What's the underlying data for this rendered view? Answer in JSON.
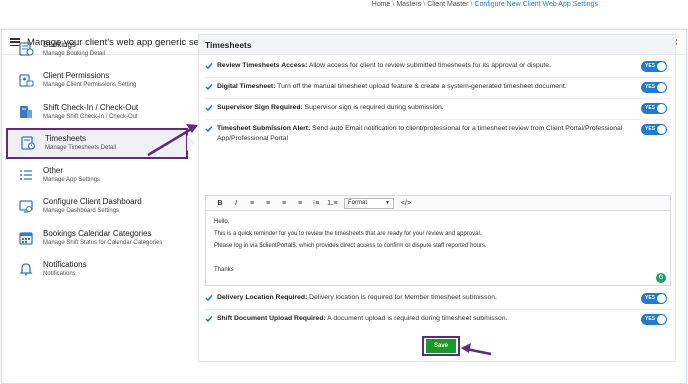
{
  "breadcrumb": {
    "items": [
      "Home",
      "Masters",
      "Client Master"
    ],
    "current": "Configure New Client Web App Settings"
  },
  "modal": {
    "title": "Manage your client's web app generic settings",
    "close_symbol": "×"
  },
  "sidebar": {
    "items": [
      {
        "title": "Bookings",
        "subtitle": "Manage Booking Detail",
        "icon": "booking-icon"
      },
      {
        "title": "Client Permissions",
        "subtitle": "Manage Client Permissions Setting",
        "icon": "permissions-icon"
      },
      {
        "title": "Shift Check-In / Check-Out",
        "subtitle": "Manage Shift Check-In / Check-Out",
        "icon": "checkin-icon"
      },
      {
        "title": "Timesheets",
        "subtitle": "Manage Timesheets Detail",
        "icon": "timesheet-icon",
        "active": true
      },
      {
        "title": "Other",
        "subtitle": "Manage App Settings",
        "icon": "list-icon"
      },
      {
        "title": "Configure Client Dashboard",
        "subtitle": "Manage Dashboard Settings",
        "icon": "dashboard-icon"
      },
      {
        "title": "Bookings Calendar Categories",
        "subtitle": "Manage Shift Status for Calendar Categories",
        "icon": "calendar-icon"
      },
      {
        "title": "Notifications",
        "subtitle": "Notifications",
        "icon": "bell-icon"
      }
    ]
  },
  "panel": {
    "title": "Timesheets",
    "settings": [
      {
        "label": "Review Timesheets Access:",
        "text": " Allow access for client to review submitted timesheets for its approval or dispute.",
        "toggle": "YES"
      },
      {
        "label": "Digital Timesheet:",
        "text": " Turn off the manual timesheet upload feature & create a system-generated timesheet document.",
        "toggle": "YES"
      },
      {
        "label": "Supervisor Sign Required:",
        "text": " Supervisor sign is required during submission.",
        "toggle": "YES"
      },
      {
        "label": "Timesheet Submission Alert:",
        "text": " Send auto Email notification to client/professional for a timesheet review from Client Portal/Professional App/Professional Portal",
        "toggle": "YES"
      },
      {
        "label": "Delivery Location Required:",
        "text": " Delivery location is required for Member timesheet submisson.",
        "toggle": "YES"
      },
      {
        "label": "Shift Document Upload Required:",
        "text": " A document upload is required during timesheet submisson.",
        "toggle": "YES"
      }
    ],
    "editor": {
      "toolbar": {
        "bold": "B",
        "italic": "I",
        "format": "Format",
        "code": "</>"
      },
      "lines": [
        "Hello,",
        "This is a quick reminder for you to review the timesheets that are ready for your review and approval.",
        "Please log in via $clientPortal$, which provides direct access to confirm or dispute staff reported hours.",
        "",
        "Thanks"
      ],
      "grammarly": "G"
    },
    "save_label": "Save"
  },
  "colors": {
    "accent": "#1f7bd8",
    "highlight": "#5e2a84",
    "save": "#139c26"
  }
}
